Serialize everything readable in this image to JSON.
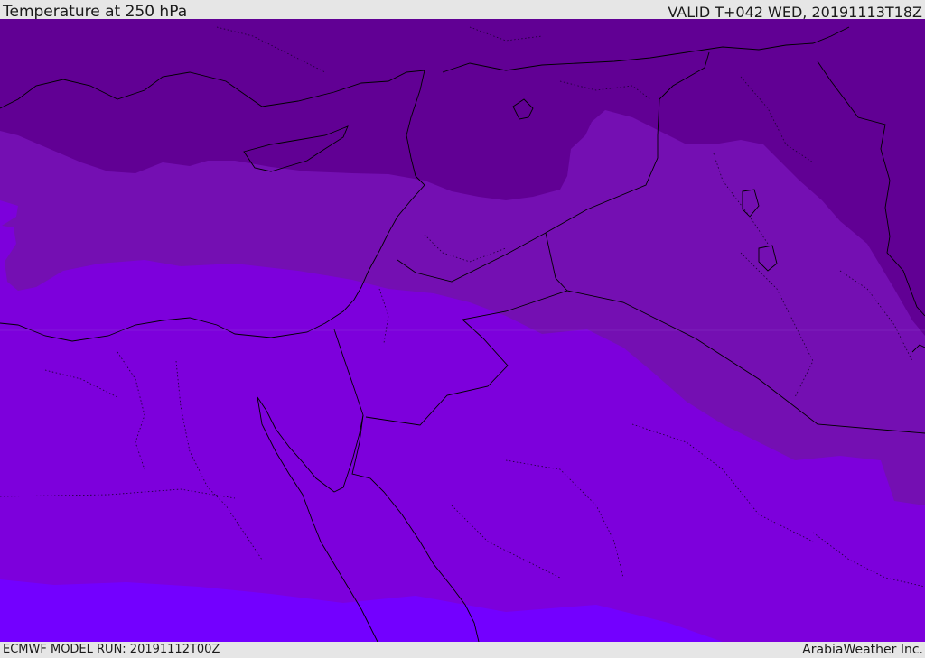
{
  "header": {
    "title": "Temperature at 250 hPa",
    "valid_time": "VALID T+042 WED, 20191113T18Z"
  },
  "footer": {
    "model_run": "ECMWF MODEL RUN: 20191112T00Z",
    "brand": "ArabiaWeather Inc."
  },
  "map": {
    "field": "Temperature at 250 hPa",
    "temperature_band_colors": [
      "#610094",
      "#740fb2",
      "#7d00dc",
      "#7300ff"
    ],
    "boundary_color": "#000000"
  }
}
